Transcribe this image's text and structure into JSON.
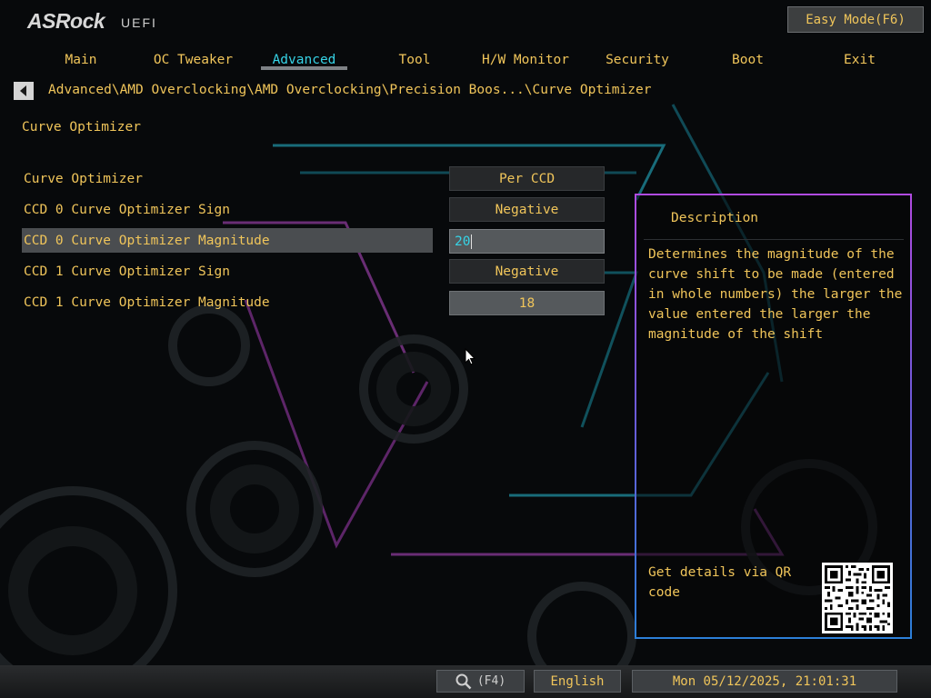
{
  "brand": {
    "logo": "ASRock",
    "subtitle": "UEFI"
  },
  "easy_mode_label": "Easy Mode(F6)",
  "tabs": [
    {
      "label": "Main"
    },
    {
      "label": "OC Tweaker"
    },
    {
      "label": "Advanced",
      "active": true
    },
    {
      "label": "Tool"
    },
    {
      "label": "H/W Monitor"
    },
    {
      "label": "Security"
    },
    {
      "label": "Boot"
    },
    {
      "label": "Exit"
    }
  ],
  "breadcrumb": "Advanced\\AMD Overclocking\\AMD Overclocking\\Precision Boos...\\Curve Optimizer",
  "page_title": "Curve Optimizer",
  "settings": [
    {
      "label": "Curve Optimizer",
      "value": "Per CCD"
    },
    {
      "label": "CCD 0 Curve Optimizer Sign",
      "value": "Negative"
    },
    {
      "label": "CCD 0 Curve Optimizer Magnitude",
      "value": "20",
      "selected": true
    },
    {
      "label": "CCD 1 Curve Optimizer Sign",
      "value": "Negative"
    },
    {
      "label": "CCD 1 Curve Optimizer Magnitude",
      "value": "18"
    }
  ],
  "description": {
    "title": "Description",
    "text": "Determines the magnitude of the curve shift to be made (entered in whole numbers) the larger the value entered the larger the magnitude of the shift",
    "qr_text": "Get details via QR code"
  },
  "bottom": {
    "search_label": "(F4)",
    "language": "English",
    "datetime": "Mon 05/12/2025, 21:01:31"
  },
  "colors": {
    "accent_text": "#f0c55a",
    "active_tab": "#36d3e6",
    "panel_border": "#b04be0"
  },
  "icons": [
    "back-arrow-icon",
    "search-icon",
    "qr-code-icon",
    "mouse-cursor-icon"
  ]
}
